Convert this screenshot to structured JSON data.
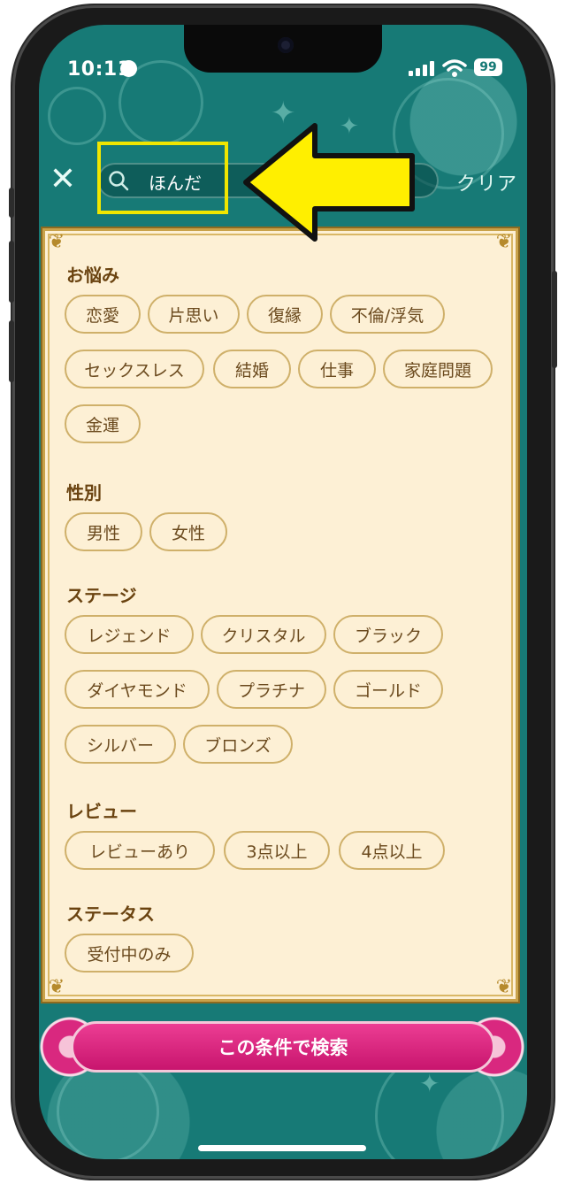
{
  "status_bar": {
    "time": "10:11",
    "battery": "99"
  },
  "header": {
    "close_label": "✕",
    "search_value": "ほんだ",
    "clear_label": "クリア"
  },
  "sections": {
    "concerns": {
      "title": "お悩み",
      "chips": [
        "恋愛",
        "片思い",
        "復縁",
        "不倫/浮気",
        "セックスレス",
        "結婚",
        "仕事",
        "家庭問題",
        "金運"
      ]
    },
    "gender": {
      "title": "性別",
      "chips": [
        "男性",
        "女性"
      ]
    },
    "stage": {
      "title": "ステージ",
      "chips": [
        "レジェンド",
        "クリスタル",
        "ブラック",
        "ダイヤモンド",
        "プラチナ",
        "ゴールド",
        "シルバー",
        "ブロンズ"
      ]
    },
    "review": {
      "title": "レビュー",
      "chips": [
        "レビューあり",
        "3点以上",
        "4点以上"
      ]
    },
    "status": {
      "title": "ステータス",
      "chips": [
        "受付中のみ"
      ]
    }
  },
  "footer": {
    "search_button_label": "この条件で検索"
  },
  "colors": {
    "background": "#177a76",
    "panel": "#fdf0d5",
    "button": "#d8207f",
    "highlight": "#f0e600"
  }
}
